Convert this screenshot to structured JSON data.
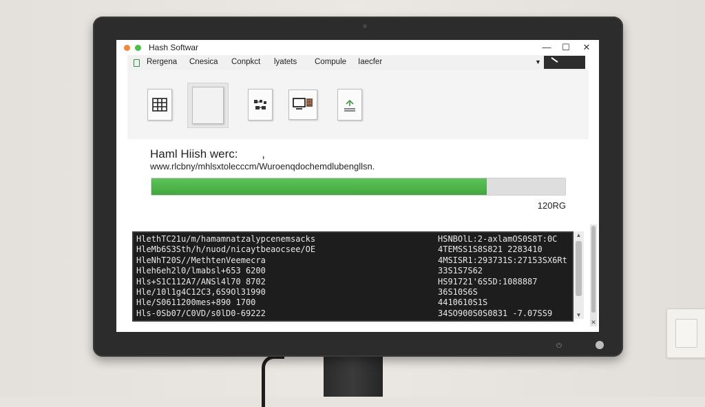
{
  "window": {
    "title": "Hash Softwar",
    "minimize": "—",
    "maximize": "☐",
    "close": "✕"
  },
  "menu": {
    "items": [
      "Rergena",
      "Cnesica",
      "Conpkct",
      "lyatets",
      "Compule",
      "Iaecfer"
    ],
    "dropdown_arrow": "▼"
  },
  "toolbar": {
    "tools": [
      {
        "name": "hash-table-doc-icon"
      },
      {
        "name": "blank-doc-icon"
      },
      {
        "name": "circuit-doc-icon"
      },
      {
        "name": "device-doc-icon"
      },
      {
        "name": "upload-doc-icon"
      }
    ]
  },
  "main": {
    "hash_label": "Haml Hiish werc:",
    "hash_label_extra": ",",
    "url": "www.rlcbny/mhlsxtolecccm/Wuroenqdochemdlubengllsn.",
    "progress": 0.81,
    "size": "120RG"
  },
  "terminal": {
    "rows": [
      [
        "HlethTC21u/m/hamamnatzalypcenemsacks",
        "HSNBOlL:2-axlamOS0S8T:0C"
      ],
      [
        "HleMb6S3Sth/h/nuod/nicaytbeaocsee/OE",
        "4TEMSS1S8S821 2283410"
      ],
      [
        "HleNhT20S//MethtenVeemecra",
        "4MSISR1:293731S:27153SX6Rt"
      ],
      [
        "Hleh6eh2l0/lmabsl+653 6200",
        "33S1S7S62"
      ],
      [
        "Hls+S1C112A7/ANSl4l70 8702",
        "HS91721'6S5D:1088887"
      ],
      [
        "Hle/10l1g4C12C3,6S9Ol31990",
        "36S10S6S"
      ],
      [
        "Hle/S0611200mes+890 1700",
        "4410610S1S"
      ],
      [
        "Hls-0Sb07/C0VD/s0lD0-69222",
        "34SO900S0S0831 -7.07SS9"
      ]
    ]
  },
  "colors": {
    "progress_green": "#4cb548",
    "terminal_bg": "#1d1d1d",
    "bezel": "#2c2c2c"
  }
}
